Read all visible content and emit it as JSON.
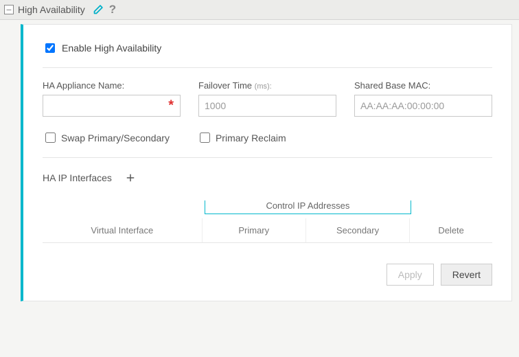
{
  "header": {
    "title": "High Availability"
  },
  "enable": {
    "label": "Enable High Availability",
    "checked": true
  },
  "fields": {
    "appliance": {
      "label": "HA Appliance Name:",
      "value": ""
    },
    "failover": {
      "label": "Failover Time",
      "unit": "(ms):",
      "value": "1000"
    },
    "mac": {
      "label": "Shared Base MAC:",
      "value": "AA:AA:AA:00:00:00"
    }
  },
  "toggles": {
    "swap": {
      "label": "Swap Primary/Secondary",
      "checked": false
    },
    "reclaim": {
      "label": "Primary Reclaim",
      "checked": false
    }
  },
  "interfaces": {
    "heading": "HA IP Interfaces",
    "group_label": "Control IP Addresses",
    "columns": {
      "vi": "Virtual Interface",
      "primary": "Primary",
      "secondary": "Secondary",
      "delete": "Delete"
    }
  },
  "actions": {
    "apply": "Apply",
    "revert": "Revert"
  }
}
